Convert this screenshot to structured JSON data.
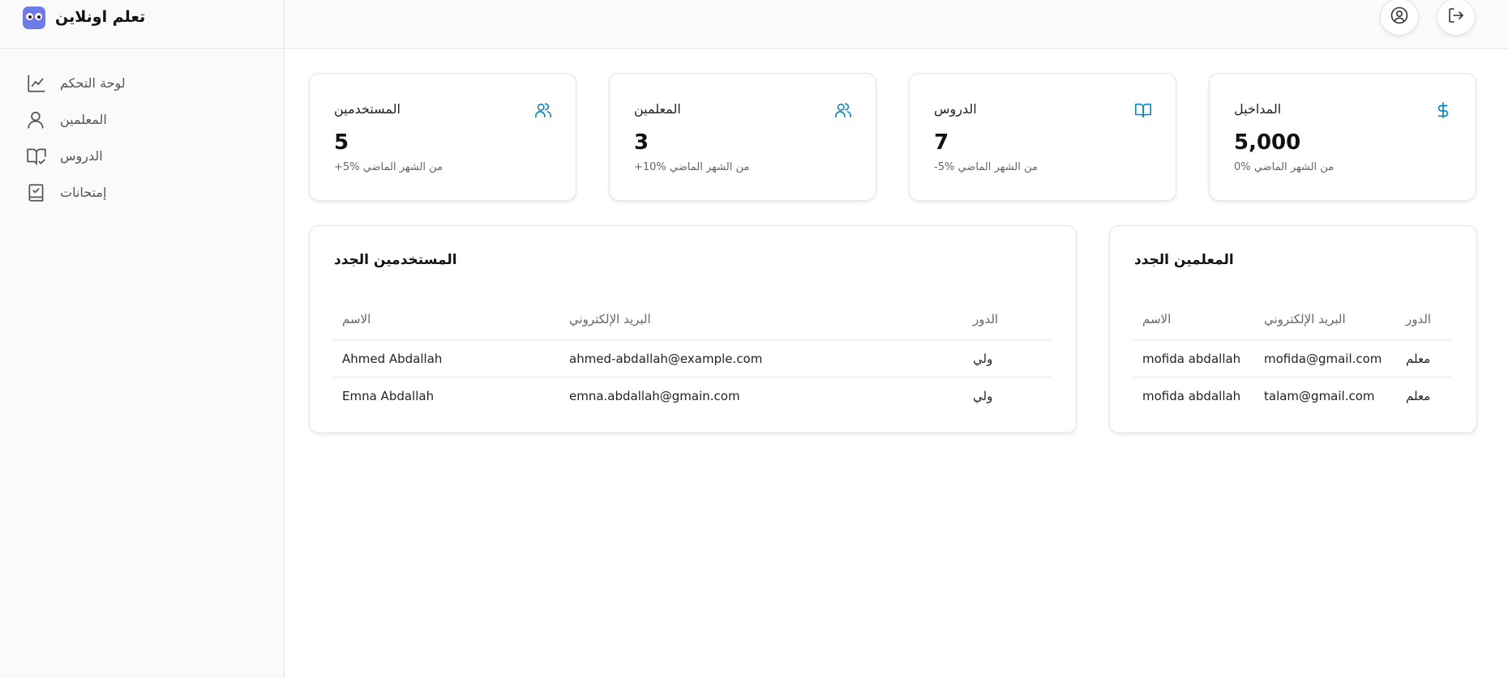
{
  "brand": {
    "name": "تعلم اونلاين"
  },
  "sidebar": {
    "items": [
      {
        "label": "لوحة التحكم",
        "icon": "chart-line-icon"
      },
      {
        "label": "المعلمين",
        "icon": "user-icon"
      },
      {
        "label": "الدروس",
        "icon": "book-open-check-icon"
      },
      {
        "label": "إمتحانات",
        "icon": "notebook-check-icon"
      }
    ]
  },
  "topbar": {
    "account_icon": "user-circle-icon",
    "logout_icon": "logout-icon"
  },
  "stats": [
    {
      "title": "المستخدمين",
      "value": "5",
      "note": "+5% من الشهر الماضي",
      "icon": "users-icon"
    },
    {
      "title": "المعلمين",
      "value": "3",
      "note": "+10% من الشهر الماضي",
      "icon": "users-icon"
    },
    {
      "title": "الدروس",
      "value": "7",
      "note": "-5% من الشهر الماضي",
      "icon": "book-open-icon"
    },
    {
      "title": "المداخيل",
      "value": "5,000",
      "note": "0% من الشهر الماضي",
      "icon": "dollar-icon"
    }
  ],
  "new_users": {
    "title": "المستخدمين الجدد",
    "columns": {
      "name": "الاسم",
      "email": "البريد الإلكتروني",
      "role": "الدور"
    },
    "rows": [
      {
        "name": "Ahmed Abdallah",
        "email": "ahmed-abdallah@example.com",
        "role": "ولي"
      },
      {
        "name": "Emna Abdallah",
        "email": "emna.abdallah@gmain.com",
        "role": "ولي"
      }
    ]
  },
  "new_teachers": {
    "title": "المعلمين الجدد",
    "columns": {
      "name": "الاسم",
      "email": "البريد الإلكتروني",
      "role": "الدور"
    },
    "rows": [
      {
        "name": "mofida abdallah",
        "email": "mofida@gmail.com",
        "role": "معلم"
      },
      {
        "name": "mofida abdallah",
        "email": "talam@gmail.com",
        "role": "معلم"
      }
    ]
  },
  "colors": {
    "accent": "#0284c7",
    "border": "#e4e4e7",
    "sidebar_bg": "#fafafa",
    "logo": "#6d7ce8"
  }
}
